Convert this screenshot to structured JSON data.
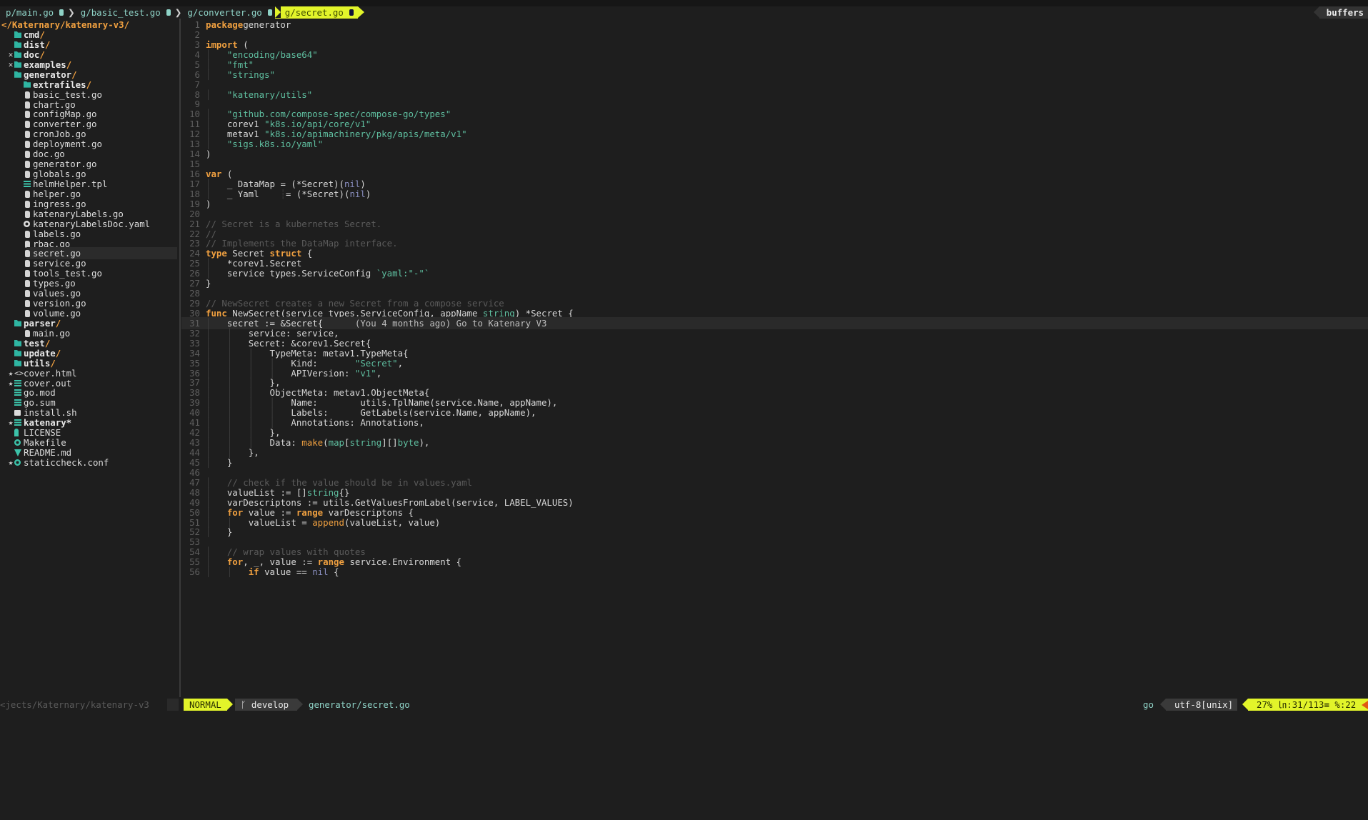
{
  "tabline": {
    "tabs": [
      {
        "label": "p/main.go",
        "active": false
      },
      {
        "label": "g/basic_test.go",
        "active": false
      },
      {
        "label": "g/converter.go",
        "active": false
      },
      {
        "label": "g/secret.go",
        "active": true
      }
    ],
    "separator": "❯",
    "buffers_label": "buffers"
  },
  "tree": {
    "root": "</Katernary/katenary-v3/",
    "items": [
      {
        "name": "cmd",
        "type": "dir",
        "depth": 1,
        "mark": ""
      },
      {
        "name": "dist",
        "type": "dir",
        "depth": 1,
        "mark": ""
      },
      {
        "name": "doc",
        "type": "dir",
        "depth": 1,
        "mark": "✕"
      },
      {
        "name": "examples",
        "type": "dir",
        "depth": 1,
        "mark": "✕"
      },
      {
        "name": "generator",
        "type": "dir",
        "depth": 1,
        "mark": ""
      },
      {
        "name": "extrafiles",
        "type": "dir",
        "depth": 2,
        "mark": ""
      },
      {
        "name": "basic_test.go",
        "type": "go",
        "depth": 2
      },
      {
        "name": "chart.go",
        "type": "go",
        "depth": 2
      },
      {
        "name": "configMap.go",
        "type": "go",
        "depth": 2
      },
      {
        "name": "converter.go",
        "type": "go",
        "depth": 2
      },
      {
        "name": "cronJob.go",
        "type": "go",
        "depth": 2
      },
      {
        "name": "deployment.go",
        "type": "go",
        "depth": 2
      },
      {
        "name": "doc.go",
        "type": "go",
        "depth": 2
      },
      {
        "name": "generator.go",
        "type": "go",
        "depth": 2
      },
      {
        "name": "globals.go",
        "type": "go",
        "depth": 2
      },
      {
        "name": "helmHelper.tpl",
        "type": "text",
        "depth": 2
      },
      {
        "name": "helper.go",
        "type": "go",
        "depth": 2
      },
      {
        "name": "ingress.go",
        "type": "go",
        "depth": 2
      },
      {
        "name": "katenaryLabels.go",
        "type": "go",
        "depth": 2
      },
      {
        "name": "katenaryLabelsDoc.yaml",
        "type": "config",
        "depth": 2
      },
      {
        "name": "labels.go",
        "type": "go",
        "depth": 2
      },
      {
        "name": "rbac.go",
        "type": "go",
        "depth": 2
      },
      {
        "name": "secret.go",
        "type": "go",
        "depth": 2,
        "selected": true
      },
      {
        "name": "service.go",
        "type": "go",
        "depth": 2
      },
      {
        "name": "tools_test.go",
        "type": "go",
        "depth": 2
      },
      {
        "name": "types.go",
        "type": "go",
        "depth": 2
      },
      {
        "name": "values.go",
        "type": "go",
        "depth": 2
      },
      {
        "name": "version.go",
        "type": "go",
        "depth": 2
      },
      {
        "name": "volume.go",
        "type": "go",
        "depth": 2
      },
      {
        "name": "parser",
        "type": "dir",
        "depth": 1,
        "mark": ""
      },
      {
        "name": "main.go",
        "type": "go",
        "depth": 2
      },
      {
        "name": "test",
        "type": "dir",
        "depth": 1,
        "mark": ""
      },
      {
        "name": "update",
        "type": "dir",
        "depth": 1,
        "mark": ""
      },
      {
        "name": "utils",
        "type": "dir",
        "depth": 1,
        "mark": ""
      },
      {
        "name": "cover.html",
        "type": "html",
        "depth": 1,
        "mark": "★"
      },
      {
        "name": "cover.out",
        "type": "text",
        "depth": 1,
        "mark": "★"
      },
      {
        "name": "go.mod",
        "type": "text",
        "depth": 1
      },
      {
        "name": "go.sum",
        "type": "text",
        "depth": 1
      },
      {
        "name": "install.sh",
        "type": "shell",
        "depth": 1
      },
      {
        "name": "katenary*",
        "type": "text-bold",
        "depth": 1,
        "mark": "★"
      },
      {
        "name": "LICENSE",
        "type": "license",
        "depth": 1
      },
      {
        "name": "Makefile",
        "type": "config-teal",
        "depth": 1
      },
      {
        "name": "README.md",
        "type": "markdown",
        "depth": 1
      },
      {
        "name": "staticcheck.conf",
        "type": "config-teal",
        "depth": 1,
        "mark": "★"
      }
    ]
  },
  "editor": {
    "cursor_line": 31,
    "blame": "(You 4 months ago) Go to Katenary V3",
    "lines": [
      [
        [
          "kw",
          "package"
        ],
        [
          "",
          "generator"
        ]
      ],
      [],
      [
        [
          "kw",
          "import"
        ],
        [
          "",
          " ("
        ]
      ],
      [
        [
          "g",
          "│   "
        ],
        [
          "str",
          "\"encoding/base64\""
        ]
      ],
      [
        [
          "g",
          "│   "
        ],
        [
          "str",
          "\"fmt\""
        ]
      ],
      [
        [
          "g",
          "│   "
        ],
        [
          "str",
          "\"strings\""
        ]
      ],
      [],
      [
        [
          "g",
          "│   "
        ],
        [
          "str",
          "\"katenary/utils\""
        ]
      ],
      [],
      [
        [
          "g",
          "│   "
        ],
        [
          "str",
          "\"github.com/compose-spec/compose-go/types\""
        ]
      ],
      [
        [
          "g",
          "│   "
        ],
        [
          "",
          "corev1 "
        ],
        [
          "str",
          "\"k8s.io/api/core/v1\""
        ]
      ],
      [
        [
          "g",
          "│   "
        ],
        [
          "",
          "metav1 "
        ],
        [
          "str",
          "\"k8s.io/apimachinery/pkg/apis/meta/v1\""
        ]
      ],
      [
        [
          "g",
          "│   "
        ],
        [
          "str",
          "\"sigs.k8s.io/yaml\""
        ]
      ],
      [
        [
          "",
          ")"
        ]
      ],
      [],
      [
        [
          "kw",
          "var"
        ],
        [
          "",
          " ("
        ]
      ],
      [
        [
          "g",
          "│   "
        ],
        [
          "",
          "_ DataMap = (*Secret)("
        ],
        [
          "nil",
          "nil"
        ],
        [
          "",
          ")"
        ]
      ],
      [
        [
          "g",
          "│   "
        ],
        [
          "",
          "_ Yaml    "
        ],
        [
          "g",
          "┆"
        ],
        [
          "",
          "= (*Secret)("
        ],
        [
          "nil",
          "nil"
        ],
        [
          "",
          ")"
        ]
      ],
      [
        [
          "",
          ")"
        ]
      ],
      [],
      [
        [
          "cmt",
          "// Secret is a kubernetes Secret."
        ]
      ],
      [
        [
          "cmt",
          "//"
        ]
      ],
      [
        [
          "cmt",
          "// Implements the DataMap interface."
        ]
      ],
      [
        [
          "kw",
          "type"
        ],
        [
          "",
          " Secret "
        ],
        [
          "kw",
          "struct"
        ],
        [
          "",
          " {"
        ]
      ],
      [
        [
          "g",
          "│   "
        ],
        [
          "",
          "*corev1.Secret"
        ]
      ],
      [
        [
          "g",
          "│   "
        ],
        [
          "",
          "service types.ServiceConfig "
        ],
        [
          "str",
          "`yaml:\"-\"`"
        ]
      ],
      [
        [
          "",
          "}"
        ]
      ],
      [],
      [
        [
          "cmt",
          "// NewSecret creates a new Secret from a compose service"
        ]
      ],
      [
        [
          "kw",
          "func"
        ],
        [
          "",
          " NewSecret(service types.ServiceConfig, appName "
        ],
        [
          "tp",
          "string"
        ],
        [
          "",
          ") *Secret {"
        ]
      ],
      [
        [
          "g",
          "│   "
        ],
        [
          "",
          "secret := &Secret{      "
        ],
        [
          "blame",
          "(You 4 months ago) Go to Katenary V3"
        ]
      ],
      [
        [
          "g",
          "│   │   "
        ],
        [
          "",
          "service: service,"
        ]
      ],
      [
        [
          "g",
          "│   │   "
        ],
        [
          "",
          "Secret: &corev1.Secret{"
        ]
      ],
      [
        [
          "g",
          "│   │   │   "
        ],
        [
          "",
          "TypeMeta: metav1.TypeMeta{"
        ]
      ],
      [
        [
          "g",
          "│   │   │   │   "
        ],
        [
          "",
          "Kind:       "
        ],
        [
          "str",
          "\"Secret\""
        ],
        [
          "",
          ","
        ]
      ],
      [
        [
          "g",
          "│   │   │   │   "
        ],
        [
          "",
          "APIVersion: "
        ],
        [
          "str",
          "\"v1\""
        ],
        [
          "",
          ","
        ]
      ],
      [
        [
          "g",
          "│   │   │   "
        ],
        [
          "",
          "},"
        ]
      ],
      [
        [
          "g",
          "│   │   │   "
        ],
        [
          "",
          "ObjectMeta: metav1.ObjectMeta{"
        ]
      ],
      [
        [
          "g",
          "│   │   │   │   "
        ],
        [
          "",
          "Name:        utils.TplName(service.Name, appName),"
        ]
      ],
      [
        [
          "g",
          "│   │   │   │   "
        ],
        [
          "",
          "Labels:      GetLabels(service.Name, appName),"
        ]
      ],
      [
        [
          "g",
          "│   │   │   │   "
        ],
        [
          "",
          "Annotations: Annotations,"
        ]
      ],
      [
        [
          "g",
          "│   │   │   "
        ],
        [
          "",
          "},"
        ]
      ],
      [
        [
          "g",
          "│   │   │   "
        ],
        [
          "",
          "Data: "
        ],
        [
          "fn",
          "make"
        ],
        [
          "",
          "("
        ],
        [
          "tp",
          "map"
        ],
        [
          "",
          "["
        ],
        [
          "tp",
          "string"
        ],
        [
          "",
          "][]"
        ],
        [
          "tp",
          "byte"
        ],
        [
          "",
          "),"
        ]
      ],
      [
        [
          "g",
          "│   │   "
        ],
        [
          "",
          "},"
        ]
      ],
      [
        [
          "g",
          "│   "
        ],
        [
          "",
          "}"
        ]
      ],
      [],
      [
        [
          "g",
          "│   "
        ],
        [
          "cmt",
          "// check if the value should be in values.yaml"
        ]
      ],
      [
        [
          "g",
          "│   "
        ],
        [
          "",
          "valueList := []"
        ],
        [
          "tp",
          "string"
        ],
        [
          "",
          "{}"
        ]
      ],
      [
        [
          "g",
          "│   "
        ],
        [
          "",
          "varDescriptons := utils.GetValuesFromLabel(service, LABEL_VALUES)"
        ]
      ],
      [
        [
          "g",
          "│   "
        ],
        [
          "kw",
          "for"
        ],
        [
          "",
          " value := "
        ],
        [
          "kw",
          "range"
        ],
        [
          "",
          " varDescriptons {"
        ]
      ],
      [
        [
          "g",
          "│   │   "
        ],
        [
          "",
          "valueList = "
        ],
        [
          "fn",
          "append"
        ],
        [
          "",
          "(valueList, value)"
        ]
      ],
      [
        [
          "g",
          "│   "
        ],
        [
          "",
          "}"
        ]
      ],
      [],
      [
        [
          "g",
          "│   "
        ],
        [
          "cmt",
          "// wrap values with quotes"
        ]
      ],
      [
        [
          "g",
          "│   "
        ],
        [
          "kw",
          "for"
        ],
        [
          "",
          ", _, value := "
        ],
        [
          "kw",
          "range"
        ],
        [
          "",
          " service.Environment {"
        ]
      ],
      [
        [
          "g",
          "│   │   "
        ],
        [
          "kw",
          "if"
        ],
        [
          "",
          " value == "
        ],
        [
          "nil",
          "nil"
        ],
        [
          "",
          " {"
        ]
      ]
    ]
  },
  "statusline": {
    "cwd": "<jects/Katernary/katenary-v3",
    "mode": "NORMAL",
    "branch_icon": "",
    "branch": "develop",
    "file": "generator/secret.go",
    "filetype": "go",
    "encoding": "utf-8[unix]",
    "position": "27% ㏑:31/113≡ %:22",
    "percent": "27%",
    "line": 31,
    "total_lines": 113,
    "column": 22
  },
  "colors": {
    "accent": "#e2f42a",
    "keyword": "#f0a040",
    "string": "#5fbfa0",
    "folder": "#2fb5a2",
    "background": "#1e1e1e"
  }
}
